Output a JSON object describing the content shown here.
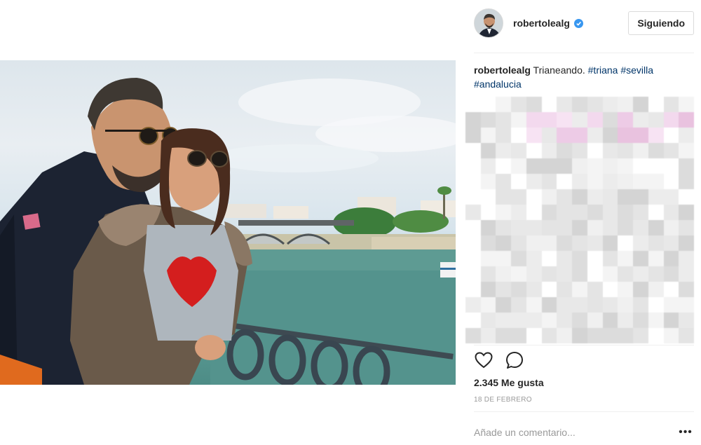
{
  "post": {
    "image_alt": "",
    "author": {
      "username": "robertolealg",
      "verified": true
    },
    "follow_button_label": "Siguiendo",
    "caption": {
      "username": "robertolealg",
      "text": "Trianeando. ",
      "hashtags": [
        "#triana",
        "#sevilla",
        "#andalucia"
      ]
    },
    "likes_label": "2.345 Me gusta",
    "date_label": "18 DE FEBRERO",
    "comment": {
      "placeholder": "Añade un comentario...",
      "value": ""
    },
    "more_options_label": "•••",
    "icons": {
      "verified": "verified-badge-icon",
      "like": "heart-outline-icon",
      "comment": "comment-bubble-icon",
      "more": "more-options-icon"
    }
  },
  "colors": {
    "accent_blue": "#3897f0",
    "hashtag": "#003569",
    "border": "#dbdbdb",
    "text": "#262626",
    "muted": "#999999"
  }
}
